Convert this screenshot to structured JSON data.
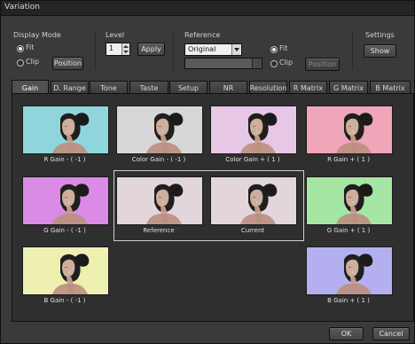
{
  "window": {
    "title": "Variation"
  },
  "display_mode": {
    "title": "Display Mode",
    "fit_label": "Fit",
    "clip_label": "Clip",
    "selected": "Fit",
    "position_button": "Position"
  },
  "level": {
    "title": "Level",
    "value": "1",
    "apply_button": "Apply"
  },
  "reference": {
    "title": "Reference",
    "select_value": "Original",
    "fit_label": "Fit",
    "clip_label": "Clip",
    "selected": "Fit",
    "position_button": "Position"
  },
  "settings": {
    "title": "Settings",
    "show_button": "Show"
  },
  "tabs": [
    {
      "label": "Gain",
      "active": true
    },
    {
      "label": "D. Range"
    },
    {
      "label": "Tone"
    },
    {
      "label": "Taste"
    },
    {
      "label": "Setup"
    },
    {
      "label": "NR"
    },
    {
      "label": "Resolution"
    },
    {
      "label": "R Matrix"
    },
    {
      "label": "G Matrix"
    },
    {
      "label": "B Matrix"
    }
  ],
  "thumbnails": {
    "r_gain_minus": {
      "label": "R Gain - ( -1 )",
      "tint": "#8fd6dc"
    },
    "color_gain_minus": {
      "label": "Color Gain - ( -1 )",
      "tint": "#d7d7d7"
    },
    "color_gain_plus": {
      "label": "Color Gain + ( 1 )",
      "tint": "#e7c7e6"
    },
    "r_gain_plus": {
      "label": "R Gain + ( 1 )",
      "tint": "#f0a5b8"
    },
    "g_gain_minus": {
      "label": "G Gain - ( -1 )",
      "tint": "#d98be6"
    },
    "reference": {
      "label": "Reference",
      "tint": "#e2d6dc"
    },
    "current": {
      "label": "Current",
      "tint": "#e2d6dc"
    },
    "g_gain_plus": {
      "label": "G Gain + ( 1 )",
      "tint": "#a6e6a5"
    },
    "b_gain_minus": {
      "label": "B Gain - ( -1 )",
      "tint": "#eef0b1"
    },
    "b_gain_plus": {
      "label": "B Gain + ( 1 )",
      "tint": "#b4b0f0"
    }
  },
  "footer": {
    "ok_button": "OK",
    "cancel_button": "Cancel"
  }
}
